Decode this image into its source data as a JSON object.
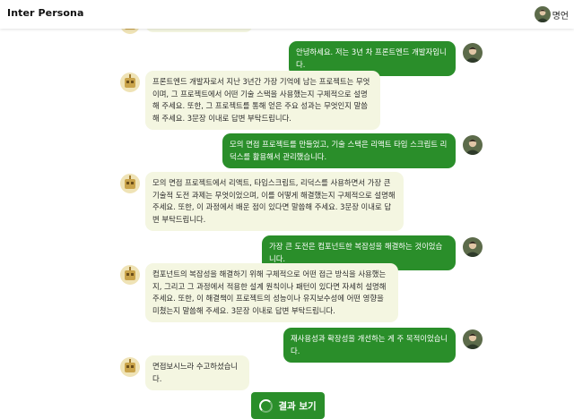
{
  "header": {
    "brand": "Inter Persona",
    "user_name": "명언"
  },
  "messages": [
    {
      "role": "me",
      "text": "안녕하세요. 저는 3년 차 프론트엔드 개발자입니다."
    },
    {
      "role": "bot",
      "text": "프론트엔드 개발자로서 지난 3년간 가장 기억에 남는 프로젝트는 무엇이며, 그 프로젝트에서 어떤 기술 스택을 사용했는지 구체적으로 설명해 주세요. 또한, 그 프로젝트를 통해 얻은 주요 성과는 무엇인지 말씀해 주세요. 3문장 이내로 답변 부탁드립니다."
    },
    {
      "role": "me",
      "text": "모의 면접 프로젝트를 만들었고, 기술 스택은 리액트 타입 스크립트 리덕스를 활용해서 관리했습니다."
    },
    {
      "role": "bot",
      "text": "모의 면접 프로젝트에서 리액트, 타입스크립트, 리덕스를 사용하면서 가장 큰 기술적 도전 과제는 무엇이었으며, 이를 어떻게 해결했는지 구체적으로 설명해 주세요. 또한, 이 과정에서 배운 점이 있다면 말씀해 주세요. 3문장 이내로 답변 부탁드립니다."
    },
    {
      "role": "me",
      "text": "가장 큰 도전은 컴포넌트한 복잡성을 해결하는 것이었습니다."
    },
    {
      "role": "bot",
      "text": "컴포넌트의 복잡성을 해결하기 위해 구체적으로 어떤 접근 방식을 사용했는지, 그리고 그 과정에서 적용한 설계 원칙이나 패턴이 있다면 자세히 설명해 주세요. 또한, 이 해결책이 프로젝트의 성능이나 유지보수성에 어떤 영향을 미쳤는지 말씀해 주세요. 3문장 이내로 답변 부탁드립니다."
    },
    {
      "role": "me",
      "text": "재사용성과 확장성을 개선하는 게 주 목적이었습니다."
    },
    {
      "role": "bot",
      "text": "면접보시느라 수고하셨습니다."
    }
  ],
  "result_button": {
    "label": "결과 보기"
  },
  "colors": {
    "accent_green": "#2a8e2a",
    "bot_bubble": "#f4f6e1"
  },
  "icons": {
    "bot_avatar": "robot-avatar-icon",
    "user_avatar": "user-photo-avatar",
    "loading": "spinner-icon"
  }
}
